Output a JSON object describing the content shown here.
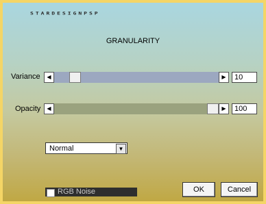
{
  "brand": "STARDESIGNPSP",
  "title": "GRANULARITY",
  "variance": {
    "label": "Variance",
    "value": "10",
    "level": 0.1,
    "track_color": "#9ca8c0"
  },
  "opacity": {
    "label": "Opacity",
    "value": "100",
    "level": 1.0,
    "track_color": "#9aa27e"
  },
  "blend_mode": {
    "selected": "Normal"
  },
  "rgb_noise": {
    "label": "RGB Noise",
    "checked": false
  },
  "buttons": {
    "ok": "OK",
    "cancel": "Cancel"
  },
  "icons": {
    "left": "◀",
    "right": "▶",
    "down": "▼"
  },
  "colors": {
    "frame": "#f4d566"
  }
}
